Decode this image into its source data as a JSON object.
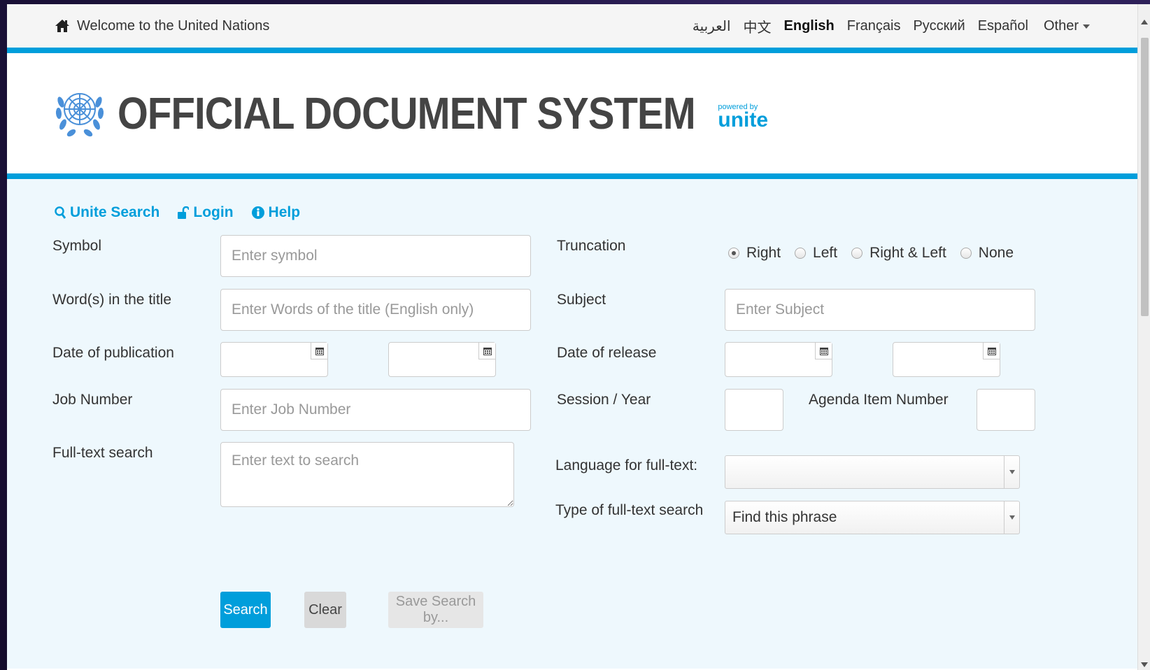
{
  "topbar": {
    "welcome": "Welcome to the United Nations",
    "languages": [
      "العربية",
      "中文",
      "English",
      "Français",
      "Русский",
      "Español"
    ],
    "active_language": "English",
    "other_label": "Other"
  },
  "header": {
    "title": "OFFICIAL DOCUMENT SYSTEM",
    "powered_by": "powered by",
    "brand": "unite"
  },
  "nav": {
    "unite_search": "Unite Search",
    "login": "Login",
    "help": "Help"
  },
  "form": {
    "symbol_label": "Symbol",
    "symbol_placeholder": "Enter symbol",
    "title_label": "Word(s) in the title",
    "title_placeholder": "Enter Words of the title (English only)",
    "pubdate_label": "Date of publication",
    "job_label": "Job Number",
    "job_placeholder": "Enter Job Number",
    "fulltext_label": "Full-text search",
    "fulltext_placeholder": "Enter text to search",
    "truncation_label": "Truncation",
    "truncation_options": [
      "Right",
      "Left",
      "Right & Left",
      "None"
    ],
    "truncation_selected": "Right",
    "subject_label": "Subject",
    "subject_placeholder": "Enter Subject",
    "release_label": "Date of release",
    "session_label": "Session / Year",
    "agenda_label": "Agenda Item Number",
    "lang_fulltext_label": "Language for full-text:",
    "lang_fulltext_value": "",
    "type_fulltext_label": "Type of full-text search",
    "type_fulltext_value": "Find this phrase"
  },
  "buttons": {
    "search": "Search",
    "clear": "Clear",
    "save_search": "Save Search by..."
  },
  "colors": {
    "accent": "#009edb",
    "main_bg": "#eef8fd"
  }
}
